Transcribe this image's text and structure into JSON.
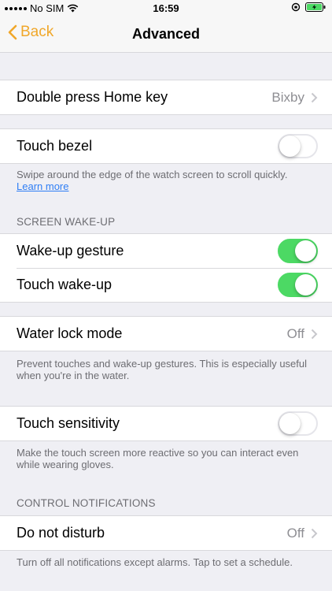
{
  "status_bar": {
    "carrier": "No SIM",
    "time": "16:59"
  },
  "nav": {
    "back_label": "Back",
    "title": "Advanced"
  },
  "rows": {
    "double_press": {
      "label": "Double press Home key",
      "value": "Bixby"
    },
    "touch_bezel": {
      "label": "Touch bezel",
      "enabled": false
    },
    "wake_gesture": {
      "label": "Wake-up gesture",
      "enabled": true
    },
    "touch_wake": {
      "label": "Touch wake-up",
      "enabled": true
    },
    "water_lock": {
      "label": "Water lock mode",
      "value": "Off"
    },
    "touch_sensitivity": {
      "label": "Touch sensitivity",
      "enabled": false
    },
    "dnd": {
      "label": "Do not disturb",
      "value": "Off"
    }
  },
  "footers": {
    "touch_bezel": "Swipe around the edge of the watch screen to scroll quickly.",
    "learn_more": "Learn more",
    "water_lock": "Prevent touches and wake-up gestures. This is especially useful when you're in the water.",
    "touch_sensitivity": "Make the touch screen more reactive so you can interact even while wearing gloves.",
    "dnd": "Turn off all notifications except alarms. Tap to set a schedule."
  },
  "sections": {
    "screen_wakeup": "SCREEN WAKE-UP",
    "control_notifications": "CONTROL NOTIFICATIONS"
  },
  "colors": {
    "accent": "#f0a72a",
    "toggle_on": "#4cd964",
    "link": "#2f7ef5"
  }
}
